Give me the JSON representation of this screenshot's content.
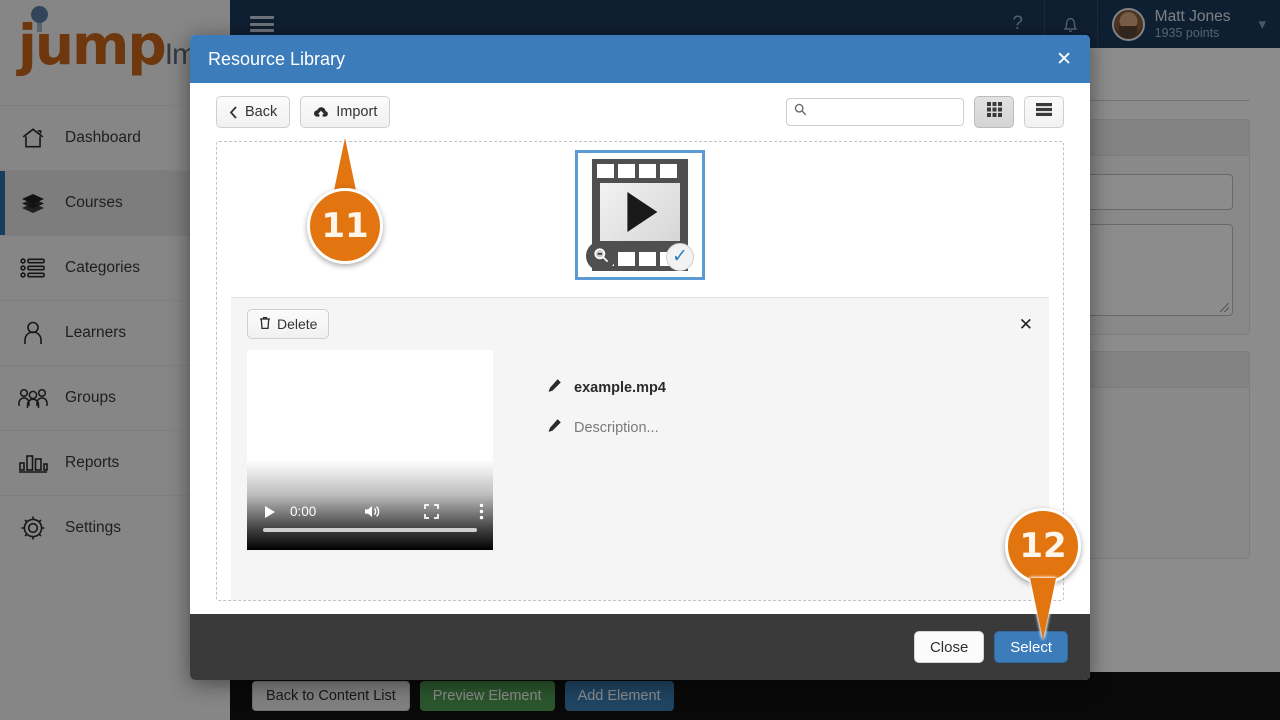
{
  "sidebar": {
    "logo": {
      "brand": "jump",
      "suffix": "Im"
    },
    "items": [
      {
        "label": "Dashboard",
        "icon": "home-icon",
        "active": false
      },
      {
        "label": "Courses",
        "icon": "books-icon",
        "active": true
      },
      {
        "label": "Categories",
        "icon": "list-icon",
        "active": false
      },
      {
        "label": "Learners",
        "icon": "user-icon",
        "active": false
      },
      {
        "label": "Groups",
        "icon": "users-icon",
        "active": false
      },
      {
        "label": "Reports",
        "icon": "bar-chart-icon",
        "active": false
      },
      {
        "label": "Settings",
        "icon": "gear-icon",
        "active": false
      }
    ]
  },
  "topbar": {
    "menu_icon": "hamburger-icon",
    "help_icon": "question-mark-icon",
    "notifications_icon": "bell-icon",
    "user_name": "Matt Jones",
    "user_points": "1935 points",
    "caret_icon": "chevron-down-icon"
  },
  "bottombar": {
    "back_label": "Back to Content List",
    "preview_label": "Preview Element",
    "add_label": "Add Element"
  },
  "modal": {
    "title": "Resource Library",
    "close_icon": "close-icon",
    "toolbar": {
      "back_label": "Back",
      "back_icon": "chevron-left-icon",
      "import_label": "Import",
      "import_icon": "cloud-upload-icon",
      "search_value": "",
      "search_placeholder": "",
      "search_icon": "search-icon",
      "grid_view_icon": "grid-view-icon",
      "list_view_icon": "list-view-icon",
      "active_view": "grid"
    },
    "library": {
      "thumbnail": {
        "type": "video",
        "icon": "film-strip-play-icon",
        "zoom_badge_icon": "zoom-out-icon",
        "selected_badge_icon": "check-circle-icon",
        "selected": true
      },
      "detail": {
        "delete_label": "Delete",
        "delete_icon": "trash-icon",
        "close_icon": "close-icon",
        "file_name": "example.mp4",
        "file_name_edit_icon": "pencil-icon",
        "description": "Description...",
        "description_edit_icon": "pencil-icon",
        "player": {
          "play_icon": "play-icon",
          "time": "0:00",
          "volume_icon": "volume-icon",
          "fullscreen_icon": "fullscreen-icon",
          "more_icon": "kebab-menu-icon",
          "progress_percent": 0
        }
      }
    },
    "footer": {
      "close_label": "Close",
      "select_label": "Select"
    }
  },
  "callouts": [
    {
      "number": "11",
      "points": "up",
      "target": "import-button"
    },
    {
      "number": "12",
      "points": "down",
      "target": "select-button"
    }
  ],
  "colors": {
    "brand_orange": "#c8651a",
    "callout_orange": "#e2750f",
    "modal_header_blue": "#3c7cba",
    "topbar_navy": "#1d3a5c",
    "accent_blue": "#2e6da4",
    "green": "#4f9d53"
  }
}
